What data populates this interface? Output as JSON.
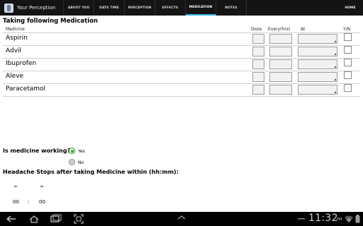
{
  "app": {
    "title": "Your Perception"
  },
  "tabs": [
    "ABOUT YOU",
    "DATE TIME",
    "PERCEPTION",
    "EFFECTS",
    "MEDICATION",
    "NOTES"
  ],
  "home_label": "HOME",
  "section_title": "Taking following Medication",
  "columns": {
    "medicine": "Medicine",
    "doze": "Doze",
    "every": "Every(hrs)",
    "at": "At",
    "yn": "Y/N"
  },
  "medicines": [
    "Aspirin",
    "Advil",
    "Ibuprofen",
    "Aleve",
    "Paracetamol"
  ],
  "question": "Is medicine working?",
  "options": {
    "yes": "Yes",
    "no": "No"
  },
  "selected_option": "Yes",
  "headache_label": "Headache Stops after taking Medicine within (hh:mm):",
  "time": {
    "hours": "00",
    "separator": ":",
    "minutes": "00"
  },
  "status": {
    "clock": "11:32",
    "ampm": "PM"
  },
  "accent_color": "#33b5e5"
}
